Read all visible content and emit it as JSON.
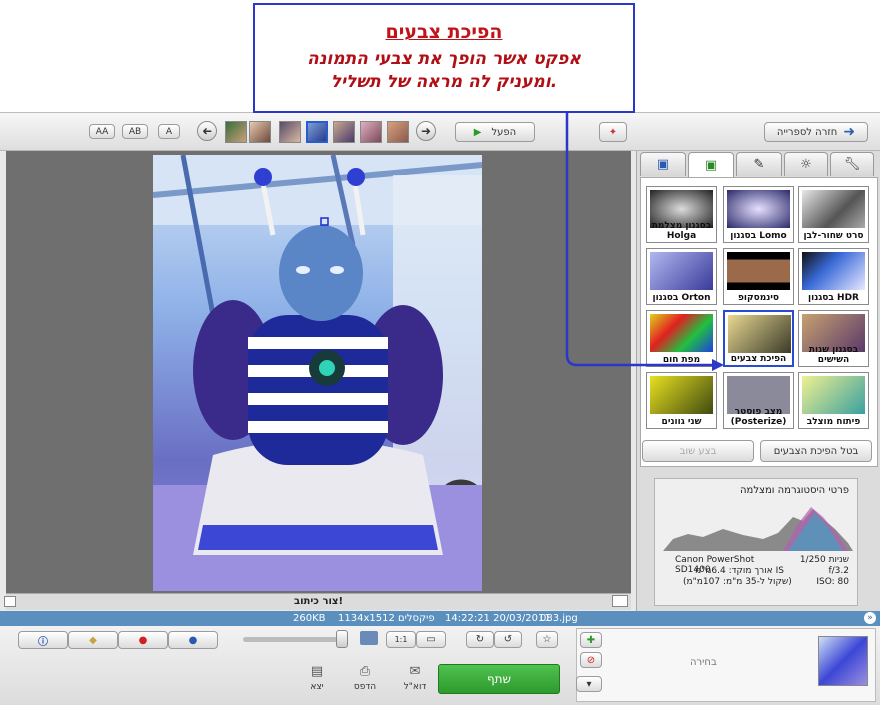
{
  "callout": {
    "title": "הפיכת צבעים",
    "line1": "אפקט אשר הופך את צבעי התמונה",
    "line2": "ומעניק לה מראה של תשליל."
  },
  "toolbar": {
    "back_label": "חזרה לספרייה",
    "play_label": "הפעל",
    "view_buttons": [
      "AA",
      "AB",
      "A"
    ]
  },
  "effects": {
    "tiles": [
      {
        "label": "סרט שחור-לבן"
      },
      {
        "label": "בסגנון Lomo"
      },
      {
        "label": "בסגנון מצלמת Holga"
      },
      {
        "label": "בסגנון HDR"
      },
      {
        "label": "סינמסקופ"
      },
      {
        "label": "בסגנון Orton"
      },
      {
        "label": "בסגנון שנות השישים"
      },
      {
        "label": "הפיכת צבעים"
      },
      {
        "label": "מפת חום"
      },
      {
        "label": "פיתוח מוצלב"
      },
      {
        "label": "מצב פוסטר (Posterize)"
      },
      {
        "label": "שני גוונים"
      }
    ],
    "undo_label": "בטל הפיכת הצבעים",
    "redo_label": "בצע שוב"
  },
  "histogram": {
    "title": "פרטי היסטוגרמה ומצלמה",
    "camera": "Canon PowerShot SD1400",
    "exposure": "1/250 שניות",
    "focal": "אורך מוקד: 6.4מ\"מ IS",
    "aperture": "f/3.2",
    "equiv": "(שקול ל-35 מ\"מ: 107מ\"מ)",
    "iso": "ISO: 80"
  },
  "caption": "צור כיתוב!",
  "file_info": {
    "filename": "083.jpg",
    "datetime": "14:22:21 20/03/2011",
    "dimensions": "1134x1512 פיקסלים",
    "size": "260KB"
  },
  "bottom": {
    "share": "שתף",
    "email": "דוא\"ל",
    "print": "הדפס",
    "export": "יצא",
    "selection": "בחירה"
  }
}
